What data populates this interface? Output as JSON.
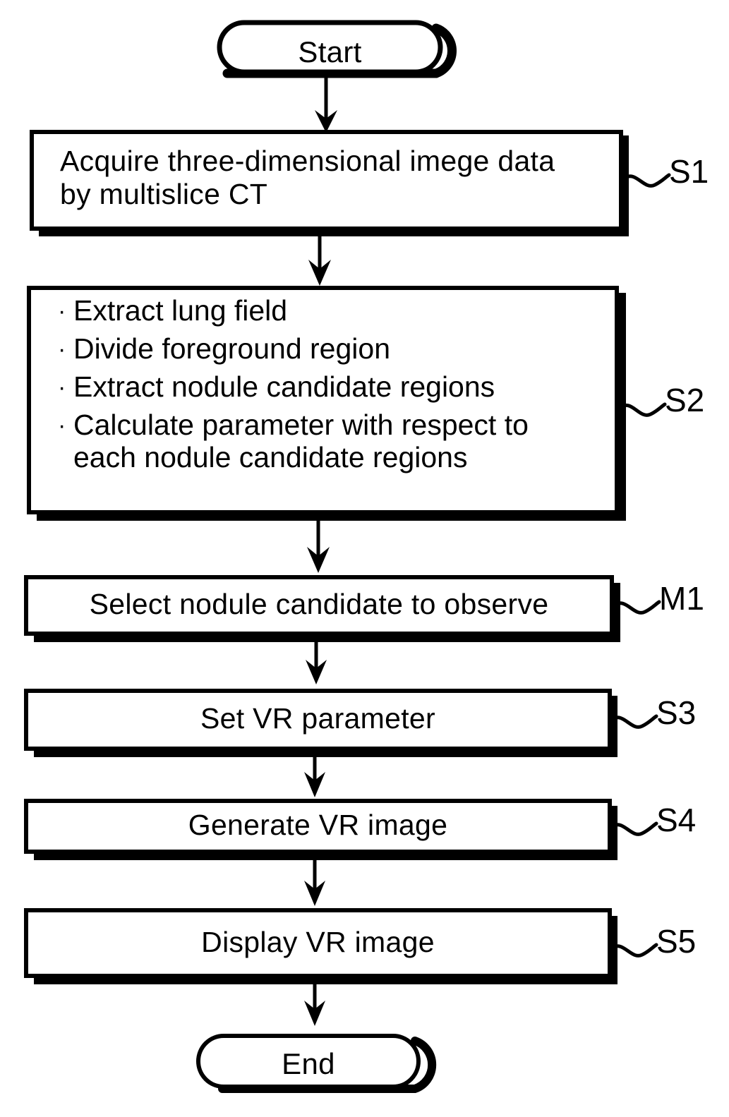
{
  "diagram": {
    "type": "flowchart",
    "title": "",
    "orientation": "vertical",
    "nodes": [
      {
        "id": "start",
        "shape": "terminal",
        "label": "Start",
        "ref": ""
      },
      {
        "id": "s1",
        "shape": "process",
        "label": "Acquire three-dimensional imege data\nby multislice CT",
        "ref": "S1"
      },
      {
        "id": "s2",
        "shape": "process",
        "label": "",
        "ref": "S2",
        "bullets": [
          "Extract lung field",
          "Divide foreground region",
          "Extract nodule candidate regions",
          "Calculate parameter with respect to\neach nodule candidate regions"
        ],
        "bullet_char": "·"
      },
      {
        "id": "m1",
        "shape": "process",
        "label": "Select nodule candidate to observe",
        "ref": "M1"
      },
      {
        "id": "s3",
        "shape": "process",
        "label": "Set VR parameter",
        "ref": "S3"
      },
      {
        "id": "s4",
        "shape": "process",
        "label": "Generate VR image",
        "ref": "S4"
      },
      {
        "id": "s5",
        "shape": "process",
        "label": "Display VR image",
        "ref": "S5"
      },
      {
        "id": "end",
        "shape": "terminal",
        "label": "End",
        "ref": ""
      }
    ],
    "edges": [
      {
        "from": "start",
        "to": "s1",
        "arrow": "down"
      },
      {
        "from": "s1",
        "to": "s2",
        "arrow": "down"
      },
      {
        "from": "s2",
        "to": "m1",
        "arrow": "down"
      },
      {
        "from": "m1",
        "to": "s3",
        "arrow": "down"
      },
      {
        "from": "s3",
        "to": "s4",
        "arrow": "down"
      },
      {
        "from": "s4",
        "to": "s5",
        "arrow": "down"
      },
      {
        "from": "s5",
        "to": "end",
        "arrow": "down"
      }
    ],
    "colors": {
      "stroke": "#000000",
      "fill": "#ffffff",
      "text": "#000000",
      "background": "#ffffff"
    }
  },
  "refs": {
    "s1": "S1",
    "s2": "S2",
    "m1": "M1",
    "s3": "S3",
    "s4": "S4",
    "s5": "S5"
  },
  "labels": {
    "start": "Start",
    "end": "End",
    "s1_line1": "Acquire three-dimensional imege data",
    "s1_line2": "by multislice CT",
    "s2_b1": "Extract lung field",
    "s2_b2": "Divide foreground region",
    "s2_b3": "Extract nodule candidate regions",
    "s2_b4": "Calculate parameter with respect to",
    "s2_b4b": "each nodule candidate regions",
    "m1": "Select nodule candidate to observe",
    "s3": "Set VR parameter",
    "s4": "Generate VR image",
    "s5": "Display VR image",
    "bullet": "·"
  }
}
